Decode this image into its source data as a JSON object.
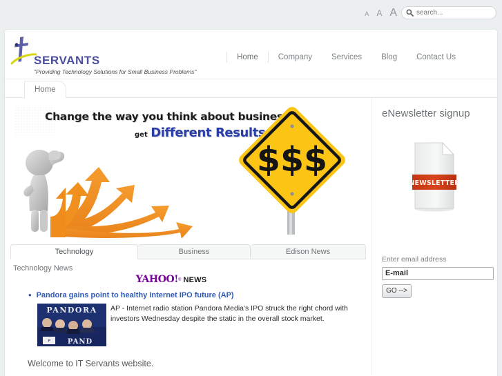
{
  "top_bar": {
    "font_sizes": [
      "A",
      "A",
      "A"
    ],
    "search": {
      "icon": "search-icon",
      "placeholder": "search...",
      "value": ""
    }
  },
  "header": {
    "logo": {
      "icon": "it-servants-cross-icon",
      "word": "SERVANTS",
      "tagline": "\"Providing Technology Solutions for Small Business Problems\""
    },
    "nav": [
      {
        "label": "Home",
        "active": true
      },
      {
        "label": "Company",
        "active": false
      },
      {
        "label": "Services",
        "active": false
      },
      {
        "label": "Blog",
        "active": false
      },
      {
        "label": "Contact Us",
        "active": false
      }
    ]
  },
  "breadcrumb": {
    "items": [
      "Home"
    ]
  },
  "banner": {
    "line1": "Change the way you think about business",
    "line2_prefix": "get",
    "line2_emphasis": "Different Results",
    "sign_text": "$$$",
    "emphasis_color": "#2b3ea6",
    "sign_color": "#fcc515",
    "arrows_color": "#ef8b21"
  },
  "tabs": [
    {
      "label": "Technology",
      "active": true
    },
    {
      "label": "Business",
      "active": false
    },
    {
      "label": "Edison News",
      "active": false
    }
  ],
  "tab_content": {
    "heading": "Technology News",
    "source": {
      "word": "YAHOO!",
      "registered": "®",
      "suffix": "NEWS"
    },
    "articles": [
      {
        "headline": "Pandora gains point to healthy Internet IPO future (AP)",
        "body": "AP - Internet radio station Pandora Media's IPO struck the right chord with investors Wednesday despite the static in the overall stock market.",
        "thumb_caption": "PANDORA"
      }
    ]
  },
  "welcome": {
    "text": "Welcome to IT Servants website."
  },
  "sidebar": {
    "title": "eNewsletter signup",
    "icon": {
      "name": "newsletter-document-icon",
      "band_label": "NEWSLETTER",
      "band_color": "#cc3a16"
    },
    "form": {
      "label": "Enter email address",
      "email_value": "E-mail",
      "email_placeholder": "E-mail",
      "submit_label": "GO -->"
    }
  }
}
